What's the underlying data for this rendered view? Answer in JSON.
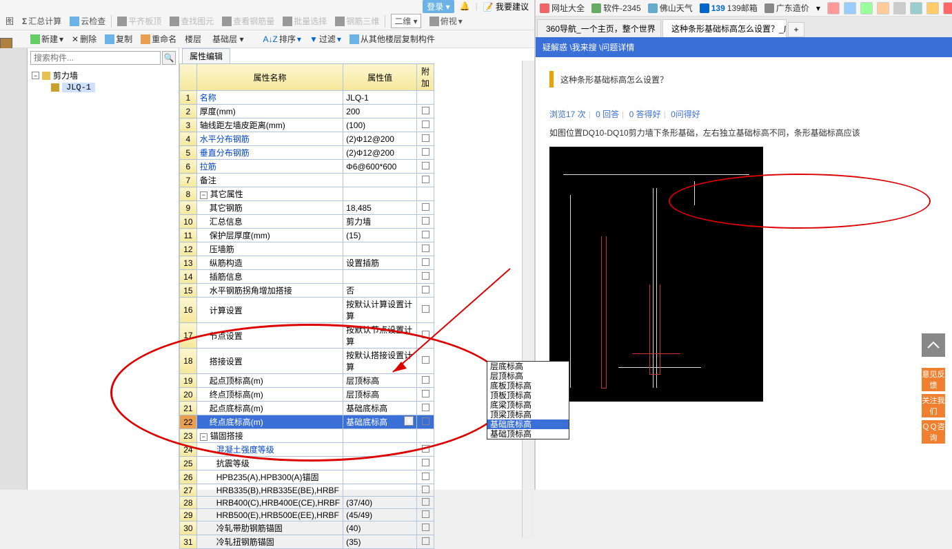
{
  "topbar": {
    "login": "登录",
    "suggest": "我要建议"
  },
  "toolbar1": {
    "tu": "图",
    "sum": "汇总计算",
    "cloud": "云检查",
    "align": "平齐板顶",
    "find": "查找图元",
    "rebar": "查看钢筋量",
    "batch": "批量选择",
    "tri": "钢筋三维",
    "view2d": "二维",
    "bird": "俯视"
  },
  "toolbar2": {
    "new": "新建",
    "del": "删除",
    "copy": "复制",
    "rename": "重命名",
    "floor": "楼层",
    "floor_sel": "基础层",
    "sort": "排序",
    "filter": "过滤",
    "copy_from": "从其他楼层复制构件"
  },
  "tree": {
    "search_ph": "搜索构件...",
    "root": "剪力墙",
    "child": "JLQ-1"
  },
  "prop": {
    "tab": "属性编辑",
    "hdr_name": "属性名称",
    "hdr_val": "属性值",
    "hdr_add": "附加",
    "rows": [
      {
        "n": "1",
        "name": "名称",
        "val": "JLQ-1",
        "link": true
      },
      {
        "n": "2",
        "name": "厚度(mm)",
        "val": "200"
      },
      {
        "n": "3",
        "name": "轴线距左墙皮距离(mm)",
        "val": "(100)"
      },
      {
        "n": "4",
        "name": "水平分布钢筋",
        "val": "(2)Φ12@200",
        "link": true
      },
      {
        "n": "5",
        "name": "垂直分布钢筋",
        "val": "(2)Φ12@200",
        "link": true
      },
      {
        "n": "6",
        "name": "拉筋",
        "val": "Φ6@600*600",
        "link": true
      },
      {
        "n": "7",
        "name": "备注",
        "val": ""
      },
      {
        "n": "8",
        "name": "其它属性",
        "val": "",
        "group": true
      },
      {
        "n": "9",
        "name": "其它钢筋",
        "val": "18,485",
        "indent": true
      },
      {
        "n": "10",
        "name": "汇总信息",
        "val": "剪力墙",
        "indent": true
      },
      {
        "n": "11",
        "name": "保护层厚度(mm)",
        "val": "(15)",
        "indent": true
      },
      {
        "n": "12",
        "name": "压墙筋",
        "val": "",
        "indent": true
      },
      {
        "n": "13",
        "name": "纵筋构造",
        "val": "设置插筋",
        "indent": true
      },
      {
        "n": "14",
        "name": "插筋信息",
        "val": "",
        "indent": true
      },
      {
        "n": "15",
        "name": "水平钢筋拐角增加搭接",
        "val": "否",
        "indent": true
      },
      {
        "n": "16",
        "name": "计算设置",
        "val": "按默认计算设置计算",
        "indent": true
      },
      {
        "n": "17",
        "name": "节点设置",
        "val": "按默认节点设置计算",
        "indent": true
      },
      {
        "n": "18",
        "name": "搭接设置",
        "val": "按默认搭接设置计算",
        "indent": true
      },
      {
        "n": "19",
        "name": "起点顶标高(m)",
        "val": "层顶标高",
        "indent": true
      },
      {
        "n": "20",
        "name": "终点顶标高(m)",
        "val": "层顶标高",
        "indent": true
      },
      {
        "n": "21",
        "name": "起点底标高(m)",
        "val": "基础底标高",
        "indent": true
      },
      {
        "n": "22",
        "name": "终点底标高(m)",
        "val": "基础底标高",
        "indent": true,
        "selected": true,
        "dd": true
      },
      {
        "n": "23",
        "name": "锚固搭接",
        "val": "",
        "group": true
      },
      {
        "n": "24",
        "name": "混凝土强度等级",
        "val": "",
        "indent2": true,
        "link": true
      },
      {
        "n": "25",
        "name": "抗震等级",
        "val": "",
        "indent2": true
      },
      {
        "n": "26",
        "name": "HPB235(A),HPB300(A)锚固",
        "val": "",
        "indent2": true
      },
      {
        "n": "27",
        "name": "HRB335(B),HRB335E(BE),HRBF",
        "val": "",
        "indent2": true
      },
      {
        "n": "28",
        "name": "HRB400(C),HRB400E(CE),HRBF",
        "val": "(37/40)",
        "indent2": true
      },
      {
        "n": "29",
        "name": "HRB500(E),HRB500E(EE),HRBF",
        "val": "(45/49)",
        "indent2": true
      },
      {
        "n": "30",
        "name": "冷轧带肋钢筋锚固",
        "val": "(40)",
        "indent2": true
      },
      {
        "n": "31",
        "name": "冷轧扭钢筋锚固",
        "val": "(35)",
        "indent2": true
      }
    ],
    "dropdown": [
      "层底标高",
      "层顶标高",
      "底板顶标高",
      "顶板顶标高",
      "底梁顶标高",
      "顶梁顶标高",
      "基础底标高",
      "基础顶标高"
    ],
    "dropdown_sel": 6
  },
  "browser": {
    "bookmarks": [
      {
        "label": "网址大全",
        "color": "#e66"
      },
      {
        "label": "软件-2345",
        "color": "#6a6"
      },
      {
        "label": "佛山天气",
        "color": "#6ac"
      },
      {
        "label": "139邮箱",
        "prefix": "139",
        "color": "#06c"
      },
      {
        "label": "广东造价",
        "color": "#888"
      }
    ],
    "tabs": [
      {
        "title": "360导航_一个主页，整个世界",
        "active": false,
        "icon": "#5c5"
      },
      {
        "title": "这种条形基础标高怎么设置？_广",
        "active": true,
        "icon": "#39d"
      }
    ],
    "newtab": "+"
  },
  "page": {
    "breadcrumb": "疑解惑 \\我来搜 \\问题详情",
    "title": "这种条形基础标高怎么设置？",
    "meta_views": "浏览17 次",
    "meta_ans": "0 回答",
    "meta_good": "0 答得好",
    "meta_ask": "0问得好",
    "body": "如图位置DQ10-DQ10剪力墙下条形基础，左右独立基础标高不同，条形基础标高应该"
  },
  "float": {
    "top": "▲",
    "fb1": "意见反馈",
    "fb2": "关注我们",
    "fb3": "ＱＱ咨询"
  }
}
